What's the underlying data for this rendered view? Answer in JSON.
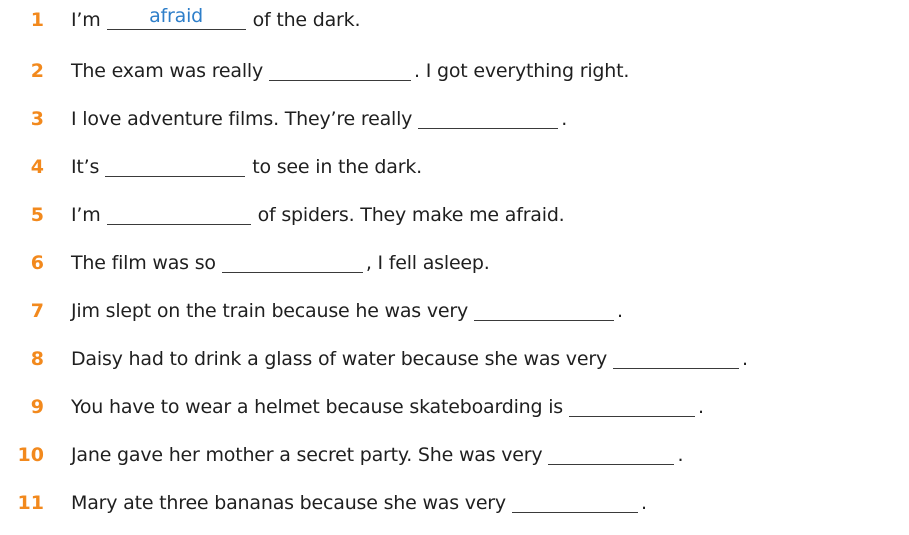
{
  "exercise": {
    "items": [
      {
        "number": "1",
        "before": "I’m",
        "answer": "afraid",
        "after": "of the dark."
      },
      {
        "number": "2",
        "before": "The exam was really",
        "answer": "",
        "after": ". I got everything right."
      },
      {
        "number": "3",
        "before": "I love adventure films. They’re really",
        "answer": "",
        "after": "."
      },
      {
        "number": "4",
        "before": "It’s",
        "answer": "",
        "after": "to see in the dark."
      },
      {
        "number": "5",
        "before": "I’m",
        "answer": "",
        "after": "of spiders. They make me afraid."
      },
      {
        "number": "6",
        "before": "The film was so",
        "answer": "",
        "after": ", I fell asleep."
      },
      {
        "number": "7",
        "before": "Jim slept on the train because he was very",
        "answer": "",
        "after": "."
      },
      {
        "number": "8",
        "before": "Daisy had to drink a glass of water because she was very",
        "answer": "",
        "after": "."
      },
      {
        "number": "9",
        "before": "You have to wear a helmet because skateboarding is",
        "answer": "",
        "after": "."
      },
      {
        "number": "10",
        "before": "Jane gave her mother a secret party. She was very",
        "answer": "",
        "after": "."
      },
      {
        "number": "11",
        "before": "Mary ate three bananas because she was very",
        "answer": "",
        "after": "."
      }
    ]
  },
  "colors": {
    "number": "#f2891d",
    "answer": "#2d7ec9",
    "text": "#1f1f1f"
  }
}
